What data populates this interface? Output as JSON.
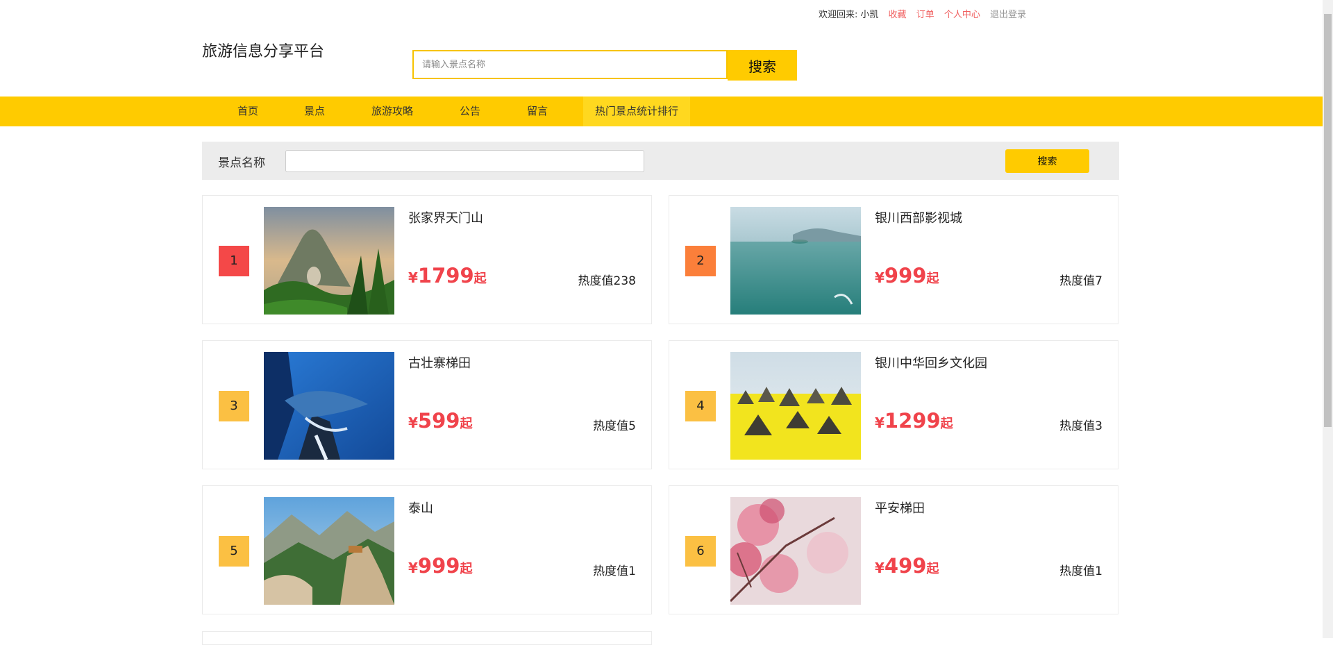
{
  "topbar": {
    "welcome": "欢迎回来:",
    "username": "小凯",
    "favorites": "收藏",
    "orders": "订单",
    "profile": "个人中心",
    "logout": "退出登录"
  },
  "header": {
    "site_title": "旅游信息分享平台",
    "search_placeholder": "请输入景点名称",
    "search_button": "搜索"
  },
  "nav": {
    "items": [
      {
        "label": "首页"
      },
      {
        "label": "景点"
      },
      {
        "label": "旅游攻略"
      },
      {
        "label": "公告"
      },
      {
        "label": "留言"
      },
      {
        "label": "热门景点统计排行"
      }
    ],
    "active_index": 5
  },
  "filter": {
    "label": "景点名称",
    "input_value": "",
    "button": "搜索"
  },
  "ranking": {
    "currency": "¥",
    "price_suffix": "起",
    "heat_prefix": "热度值",
    "items": [
      {
        "rank": "1",
        "name": "张家界天门山",
        "price": "1799",
        "heat": "238",
        "rank_color": "#f44848"
      },
      {
        "rank": "2",
        "name": "银川西部影视城",
        "price": "999",
        "heat": "7",
        "rank_color": "#fb7f3a"
      },
      {
        "rank": "3",
        "name": "古壮寨梯田",
        "price": "599",
        "heat": "5",
        "rank_color": "#fbc043"
      },
      {
        "rank": "4",
        "name": "银川中华回乡文化园",
        "price": "1299",
        "heat": "3",
        "rank_color": "#fbc043"
      },
      {
        "rank": "5",
        "name": "泰山",
        "price": "999",
        "heat": "1",
        "rank_color": "#fbc043"
      },
      {
        "rank": "6",
        "name": "平安梯田",
        "price": "499",
        "heat": "1",
        "rank_color": "#fbc043"
      }
    ]
  },
  "colors": {
    "brand_yellow": "#ffcb00",
    "price_red": "#f0434b",
    "link_red": "#f06060"
  }
}
